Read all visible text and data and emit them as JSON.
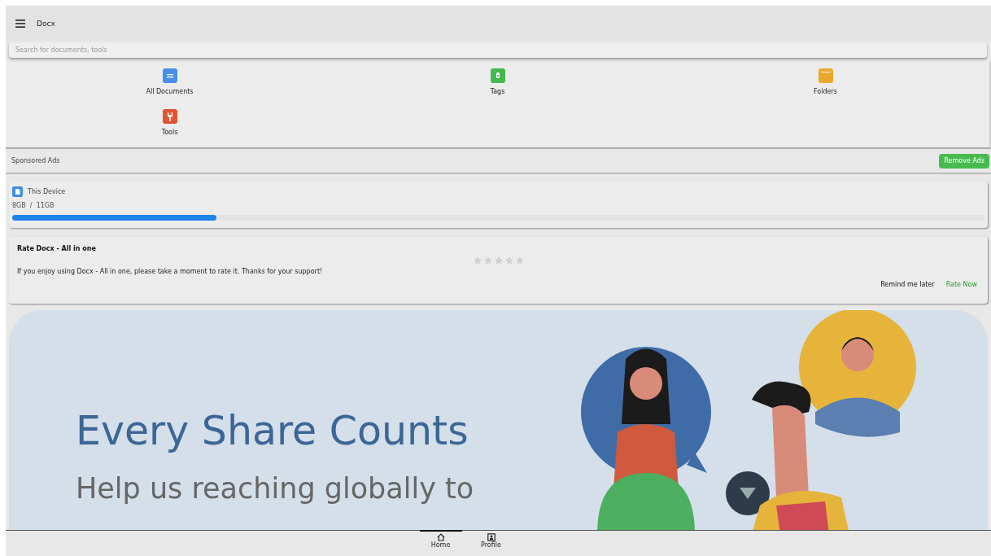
{
  "app_bar": {
    "title": "Docx"
  },
  "search": {
    "placeholder": "Search for documents, tools"
  },
  "shortcuts": [
    {
      "label": "All Documents",
      "kind": "documents",
      "color": "#4a8ee8"
    },
    {
      "label": "Tags",
      "kind": "tag",
      "color": "#45b94f"
    },
    {
      "label": "Folders",
      "kind": "folder",
      "color": "#e8a92e"
    },
    {
      "label": "Tools",
      "kind": "tools",
      "color": "#dd5533"
    }
  ],
  "ads": {
    "label": "Sponsored Ads",
    "button": "Remove Ads"
  },
  "storage": {
    "name": "This Device",
    "usage": "8GB  /  11GB",
    "level": 0.21
  },
  "rating": {
    "title": "Rate Docx - All in one",
    "stars": 0,
    "message": "If you enjoy using Docx - All in one, please take a moment to rate it. Thanks for your support!",
    "buttons": [
      {
        "label": "Remind me later",
        "kind": "secondary"
      },
      {
        "label": "Rate Now",
        "kind": "primary"
      }
    ]
  },
  "banner": {
    "headline": "Every Share Counts",
    "subline": "Help us reaching globally to"
  },
  "bottom_nav": [
    {
      "label": "Home",
      "kind": "home",
      "selected": true
    },
    {
      "label": "Profile",
      "kind": "profile",
      "selected": false
    }
  ]
}
